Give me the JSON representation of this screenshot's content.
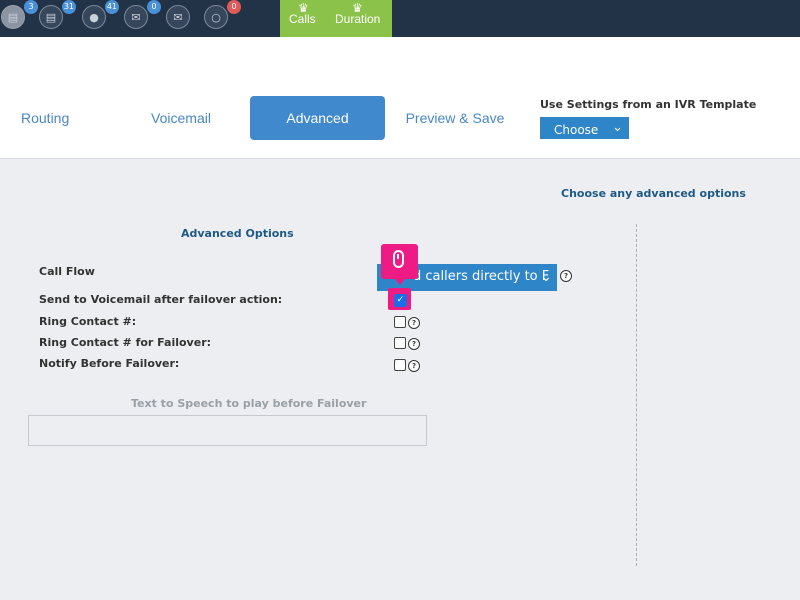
{
  "topbar": {
    "icons": [
      {
        "name": "document-icon",
        "badge": "3"
      },
      {
        "name": "document-icon",
        "badge": "31"
      },
      {
        "name": "chat-icon",
        "badge": "41"
      },
      {
        "name": "mail-icon",
        "badge": "0"
      },
      {
        "name": "envelope-open-icon",
        "badge": ""
      },
      {
        "name": "speech-bubble-icon",
        "badge": "0"
      }
    ],
    "tabs": [
      {
        "label": "Calls",
        "icon": "crown-icon"
      },
      {
        "label": "Duration",
        "icon": "crown-icon"
      }
    ]
  },
  "steps": {
    "routing": "Routing",
    "voicemail": "Voicemail",
    "advanced": "Advanced",
    "preview": "Preview & Save",
    "active": "Advanced"
  },
  "template": {
    "label": "Use Settings from an IVR Template",
    "value": "Choose"
  },
  "advanced": {
    "heading": "Choose any advanced options",
    "section_title": "Advanced Options",
    "call_flow_label": "Call Flow",
    "call_flow_value": "d callers directly to F",
    "voicemail_failover_label": "Send to Voicemail after failover action:",
    "voicemail_failover_checked": true,
    "ring_contact_label": "Ring Contact #:",
    "ring_contact_failover_label": "Ring Contact # for Failover:",
    "notify_failover_label": "Notify Before Failover:",
    "tts_label": "Text to Speech to play before Failover",
    "tts_value": ""
  },
  "colors": {
    "topbar": "#223247",
    "accent_green": "#8bc34a",
    "accent_blue": "#3f89cc",
    "highlight_pink": "#ef1b85"
  }
}
